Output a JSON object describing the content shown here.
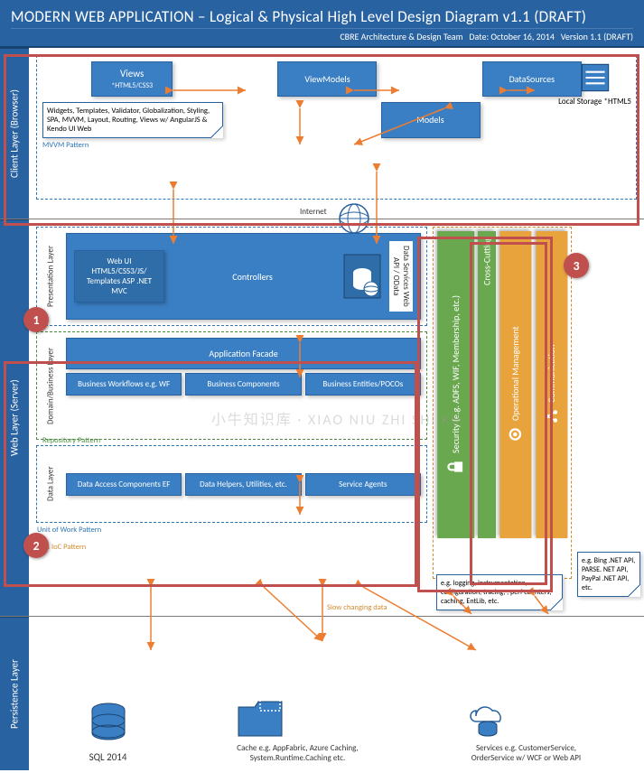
{
  "header": {
    "title": "MODERN WEB APPLICATION – Logical & Physical High Level Design Diagram v1.1 (DRAFT)",
    "team": "CBRE Architecture & Design Team",
    "date": "Date: October 16, 2014",
    "version": "Version 1.1 (DRAFT)"
  },
  "layers": {
    "client": "Client Layer (Browser)",
    "web": "Web Layer (Server)",
    "persistence": "Persistence Layer"
  },
  "sublabels": {
    "presentation": "Presentation Layer",
    "domain": "Domain/Business Layer",
    "data": "Data Layer"
  },
  "client": {
    "views": {
      "t": "Views",
      "s": "*HTML5/CSS3"
    },
    "viewmodels": "ViewModels",
    "datasources": "DataSources",
    "models": "Models",
    "storage": "Local Storage *HTML5",
    "note": "Widgets, Templates, Validator, Globalization, Styling, SPA, MVVM, Layout, Routing, Views w/ AngularJS & Kendo UI Web",
    "pattern": "MVVM Pattern",
    "internet": "Internet"
  },
  "pres": {
    "webui": "Web UI HTML5/CSS3/JS/ Templates ASP .NET MVC",
    "controllers": "Controllers",
    "dataservices": "Data Services Web API / OData"
  },
  "domain": {
    "facade": "Application Facade",
    "wf": "Business Workflows e.g. WF",
    "comp": "Business Components",
    "ent": "Business Entities/POCOs",
    "pattern": "Repository Pattern"
  },
  "data": {
    "dac": "Data Access Components EF",
    "helpers": "Data Helpers, Utilities, etc.",
    "agents": "Service Agents",
    "pattern": "Unit of Work Pattern"
  },
  "di": "DI & IoC Pattern",
  "slow": "Slow changing data",
  "cc": {
    "title": "Cross-Cutting",
    "sec": "Security (e.g. ADFS, WIF, Membership, etc.)",
    "op": "Operational Management",
    "com": "Communication",
    "opnote": "e.g. logging, instrumentation, configuration, tracing, , perf counters, caching, EntLib, etc.",
    "comnote": "e.g. Bing .NET API, PARSE. NET API, PayPal .NET API, etc."
  },
  "pers": {
    "sql": "SQL 2014",
    "cache": "Cache e.g. AppFabric, Azure Caching, System.Runtime.Caching etc.",
    "svc": "Services e.g. CustomerService, OrderService w/ WCF or Web API"
  },
  "watermark": "小牛知识库 · XIAO NIU ZHI SHI KU"
}
